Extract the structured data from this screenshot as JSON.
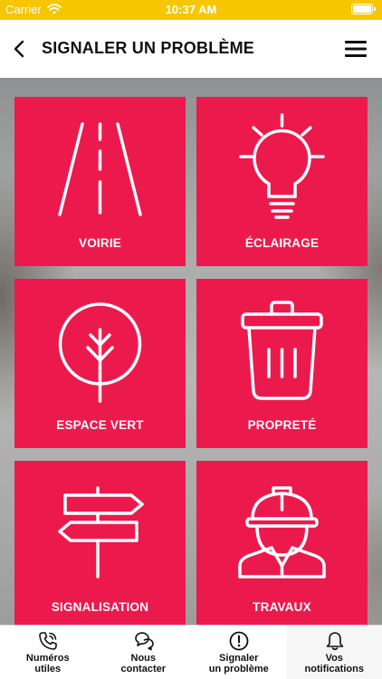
{
  "status_bar": {
    "carrier": "Carrier",
    "time": "10:37 AM",
    "wifi_icon": "wifi-icon",
    "battery_level": 1.0
  },
  "header": {
    "title": "SIGNALER UN PROBLÈME",
    "back_icon": "chevron-left-icon",
    "menu_icon": "hamburger-menu-icon"
  },
  "colors": {
    "status_bar": "#f7c600",
    "tile": "#ec1a4c",
    "tile_content": "#ffffff",
    "text": "#111111"
  },
  "categories": [
    {
      "label": "VOIRIE",
      "icon": "road-icon"
    },
    {
      "label": "ÉCLAIRAGE",
      "icon": "light-bulb-icon"
    },
    {
      "label": "ESPACE VERT",
      "icon": "tree-icon"
    },
    {
      "label": "PROPRETÉ",
      "icon": "trash-can-icon"
    },
    {
      "label": "SIGNALISATION",
      "icon": "signpost-icon"
    },
    {
      "label": "TRAVAUX",
      "icon": "construction-worker-icon"
    }
  ],
  "tabs": [
    {
      "label": "Numéros\nutiles",
      "icon": "phone-icon",
      "active": false
    },
    {
      "label": "Nous\ncontacter",
      "icon": "chat-bubbles-icon",
      "active": false
    },
    {
      "label": "Signaler\nun problème",
      "icon": "alert-circle-icon",
      "active": false
    },
    {
      "label": "Vos\nnotifications",
      "icon": "bell-icon",
      "active": true
    }
  ]
}
